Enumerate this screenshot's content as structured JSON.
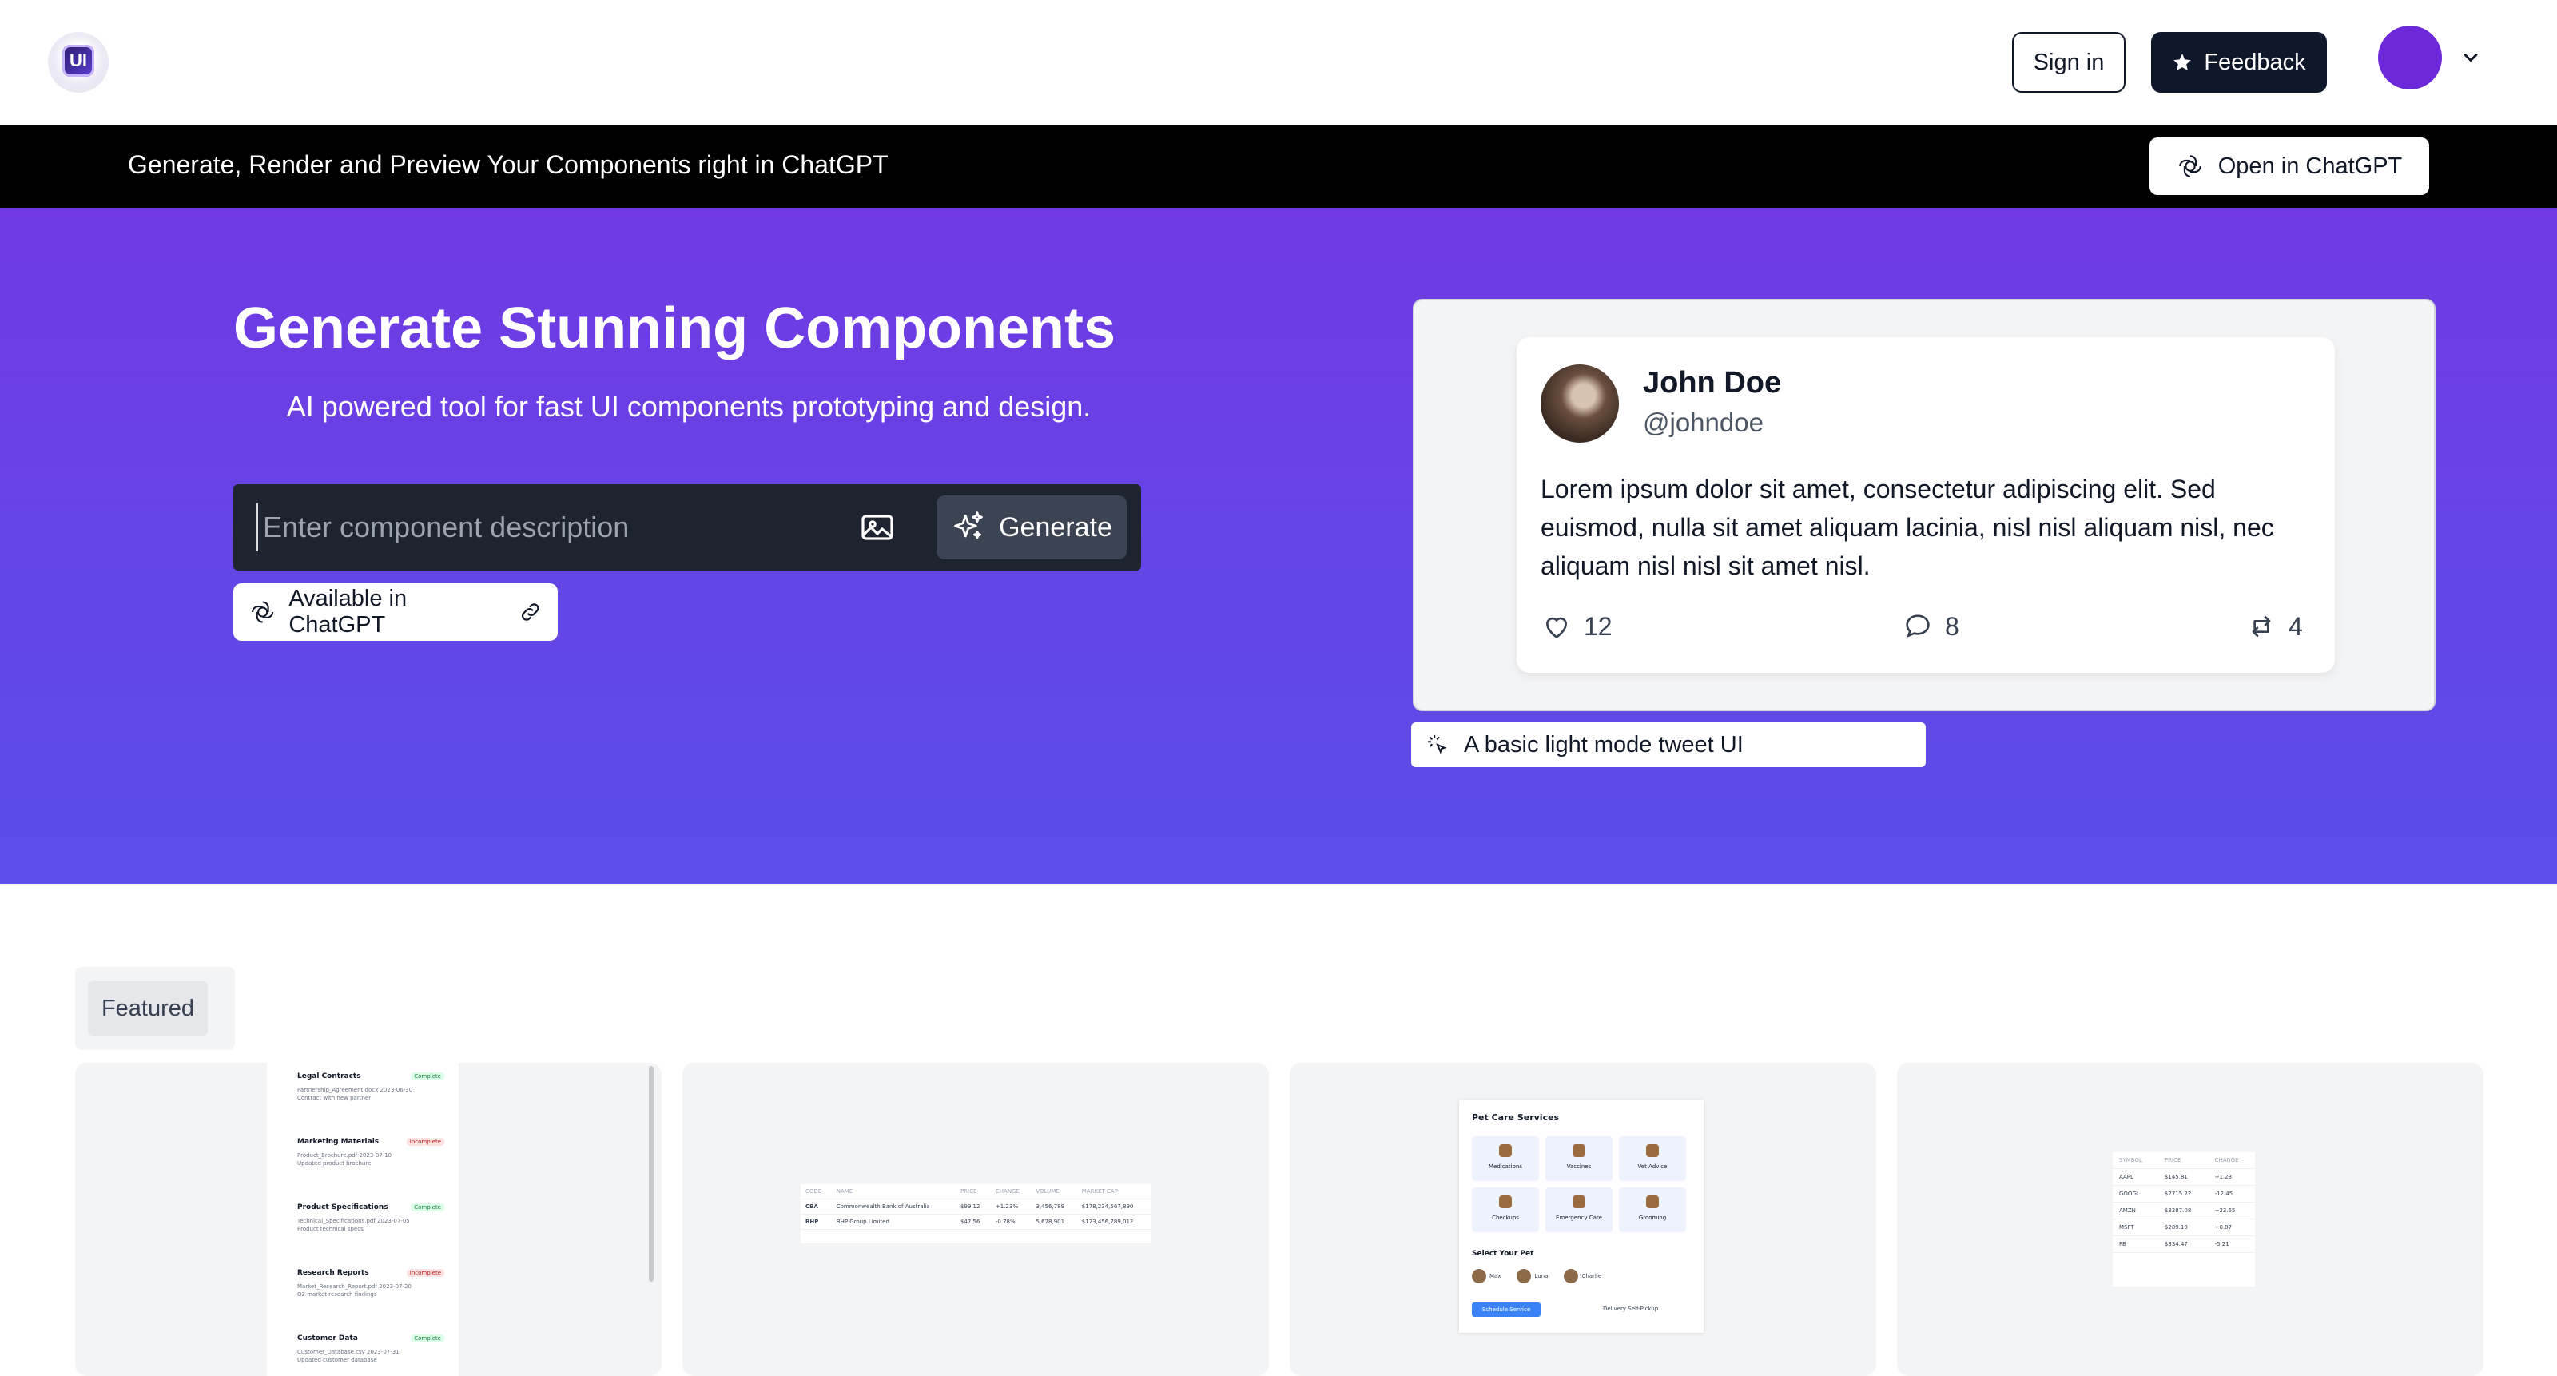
{
  "header": {
    "logo_text": "UI",
    "signin_label": "Sign in",
    "feedback_label": "Feedback"
  },
  "banner": {
    "text": "Generate, Render and Preview Your Components right in ChatGPT",
    "open_label": "Open in ChatGPT"
  },
  "hero": {
    "title": "Generate Stunning Components",
    "subtitle": "AI powered tool for fast UI components prototyping and design.",
    "input_placeholder": "Enter component description",
    "generate_label": "Generate",
    "chatgpt_chip": "Available in ChatGPT"
  },
  "preview": {
    "tweet": {
      "name": "John Doe",
      "handle": "@johndoe",
      "body": "Lorem ipsum dolor sit amet, consectetur adipiscing elit. Sed euismod, nulla sit amet aliquam lacinia, nisl nisl aliquam nisl, nec aliquam nisl nisl sit amet nisl.",
      "likes": "12",
      "comments": "8",
      "retweets": "4"
    },
    "description": "A basic light mode tweet UI"
  },
  "featured": {
    "tab_label": "Featured",
    "card1": {
      "items": [
        {
          "title": "Legal Contracts",
          "badge": "Complete",
          "file": "Partnership_Agreement.docx",
          "date": "2023-06-30",
          "desc": "Contract with new partner"
        },
        {
          "title": "Marketing Materials",
          "badge": "Incomplete",
          "file": "Product_Brochure.pdf",
          "date": "2023-07-10",
          "desc": "Updated product brochure"
        },
        {
          "title": "Product Specifications",
          "badge": "Complete",
          "file": "Technical_Specifications.pdf",
          "date": "2023-07-05",
          "desc": "Product technical specs"
        },
        {
          "title": "Research Reports",
          "badge": "Incomplete",
          "file": "Market_Research_Report.pdf",
          "date": "2023-07-20",
          "desc": "Q2 market research findings"
        },
        {
          "title": "Customer Data",
          "badge": "Complete",
          "file": "Customer_Database.csv",
          "date": "2023-07-31",
          "desc": "Updated customer database"
        }
      ]
    },
    "card2": {
      "headers": [
        "CODE",
        "NAME",
        "PRICE",
        "CHANGE",
        "VOLUME",
        "MARKET CAP"
      ],
      "rows": [
        [
          "CBA",
          "Commonwealth Bank of Australia",
          "$99.12",
          "+1.23%",
          "3,456,789",
          "$178,234,567,890"
        ],
        [
          "BHP",
          "BHP Group Limited",
          "$47.56",
          "-0.78%",
          "5,678,901",
          "$123,456,789,012"
        ]
      ]
    },
    "card3": {
      "title": "Pet Care Services",
      "services": [
        "Medications",
        "Vaccines",
        "Vet Advice",
        "Checkups",
        "Emergency Care",
        "Grooming"
      ],
      "subtitle": "Select Your Pet",
      "pets": [
        "Max",
        "Luna",
        "Charlie"
      ],
      "button": "Schedule Service",
      "options": "Delivery   Self-Pickup"
    },
    "card4": {
      "headers": [
        "SYMBOL",
        "PRICE",
        "CHANGE"
      ],
      "rows": [
        [
          "AAPL",
          "$145.81",
          "+1.23"
        ],
        [
          "GOOGL",
          "$2715.22",
          "-12.45"
        ],
        [
          "AMZN",
          "$3287.08",
          "+23.65"
        ],
        [
          "MSFT",
          "$289.10",
          "+0.87"
        ],
        [
          "FB",
          "$334.47",
          "-5.21"
        ]
      ]
    }
  },
  "colors": {
    "hero_top": "#7139e3",
    "hero_bottom": "#5a4ee6",
    "banner": "#000000",
    "accent_avatar": "#6d28d9"
  }
}
